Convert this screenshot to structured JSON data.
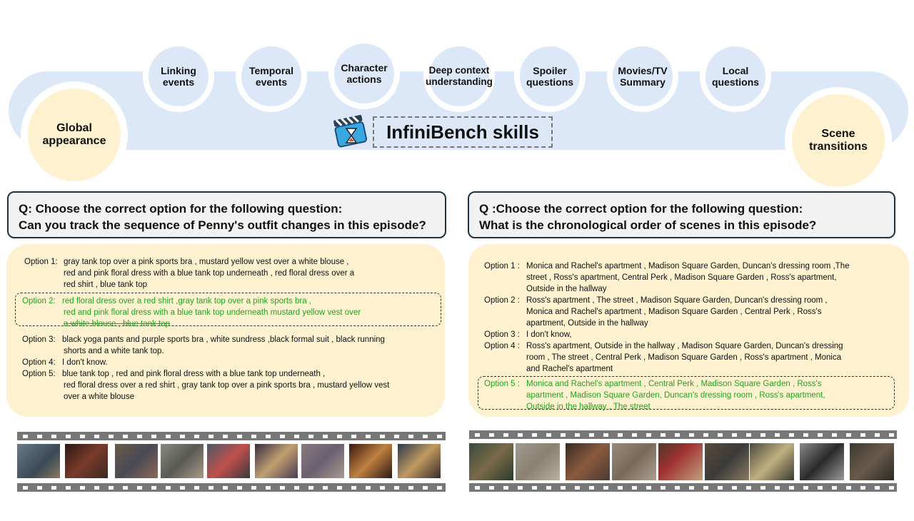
{
  "banner": {
    "title": "InfiniBench skills",
    "skills": [
      {
        "id": "linking",
        "lines": [
          "Linking",
          "events"
        ]
      },
      {
        "id": "temporal",
        "lines": [
          "Temporal",
          "events"
        ]
      },
      {
        "id": "character",
        "lines": [
          "Character",
          "actions"
        ]
      },
      {
        "id": "deep",
        "lines": [
          "Deep context",
          "understanding"
        ]
      },
      {
        "id": "spoiler",
        "lines": [
          "Spoiler",
          "questions"
        ]
      },
      {
        "id": "summary",
        "lines": [
          "Movies/TV",
          "Summary"
        ]
      },
      {
        "id": "local",
        "lines": [
          "Local",
          "questions"
        ]
      }
    ],
    "global": [
      "Global",
      "appearance"
    ],
    "scene": [
      "Scene",
      "transitions"
    ]
  },
  "left": {
    "question": [
      "Q: Choose the correct option for the following question:",
      "Can you track the sequence of Penny's outfit changes in this episode?"
    ],
    "options": [
      {
        "label": "Option 1:",
        "lines": [
          "gray tank top over a pink sports bra , mustard  yellow vest over a white blouse  ,",
          "red and pink floral dress with  a blue  tank top underneath  , red floral  dress  over a",
          " red shirt  , blue tank top"
        ]
      },
      {
        "label": "Option 2:",
        "correct": true,
        "lines": [
          "red floral  dress  over a red shirt  ,gray tank top over a pink sports  bra  ,",
          "red and pink floral dress with  a blue  tank top underneath  mustard  yellow vest over",
          "a white blouse  , blue tank top"
        ]
      },
      {
        "label": "Option 3:",
        "lines": [
          "black yoga pants and purple sports bra , white sundress  ,black formal suit , black running",
          "shorts and a white tank top."
        ]
      },
      {
        "label": "Option 4:",
        "lines": [
          "I don't know."
        ]
      },
      {
        "label": "Option 5:",
        "lines": [
          "blue tank top , red and pink floral dress with  a blue tank top underneath  ,",
          "red floral dress over a red shirt , gray tank top over a pink sports bra , mustard  yellow vest",
          "over a white blouse"
        ]
      }
    ]
  },
  "right": {
    "question": [
      "Q :Choose the correct option for the following question:",
      "What is the chronological order of scenes in this episode?"
    ],
    "options": [
      {
        "label": "Option 1 :",
        "lines": [
          "Monica  and Rachel's apartment  , Madison Square Garden,  Duncan's dressing  room ,The",
          "street  , Ross's apartment,  Central Perk , Madison Square Garden  , Ross's apartment,",
          "Outside in the hallway"
        ]
      },
      {
        "label": "Option 2 :",
        "lines": [
          "Ross's apartment  , The street  , Madison Square Garden,  Duncan's dressing room  ,",
          "Monica and Rachel's apartment  , Madison Square Garden  , Central Perk  , Ross's",
          "apartment,  Outside in the hallway"
        ]
      },
      {
        "label": "Option 3 :",
        "lines": [
          "I don't know,"
        ]
      },
      {
        "label": "Option 4 :",
        "lines": [
          "Ross's apartment,  Outside in the hallway  , Madison Square Garden,  Duncan's dressing",
          "room  , The street  , Central Perk , Madison Square Garden  , Ross's apartment  , Monica",
          "and Rachel's apartment"
        ]
      },
      {
        "label": "Option 5 :",
        "correct": true,
        "lines": [
          "Monica  and Rachel's apartment  , Central Perk  , Madison Square Garden  , Ross's",
          "apartment  , Madison Square Garden,  Duncan's dressing  room  , Ross's apartment,",
          "Outside in the hallway  , The street"
        ]
      }
    ]
  },
  "colors": {
    "band": "#dce8f8",
    "highlight": "#fdf1cf",
    "correct": "#1fa51f",
    "border": "#1e3342"
  }
}
